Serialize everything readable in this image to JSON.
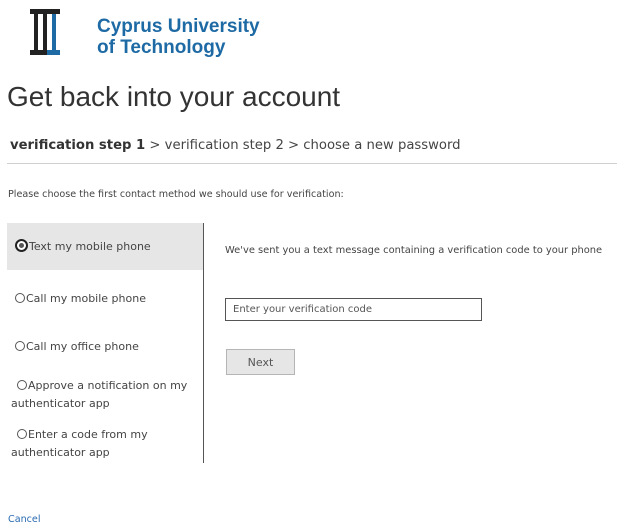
{
  "logo": {
    "line1": "Cyprus University",
    "line2": "of Technology",
    "brand_color": "#1e6aa5"
  },
  "page_title": "Get back into your account",
  "steps": {
    "current": "verification step 1",
    "rest": " > verification step 2 > choose a new password"
  },
  "instructions": "Please choose the first contact method we should use for verification:",
  "methods": [
    {
      "label": "Text my mobile phone",
      "selected": true
    },
    {
      "label": "Call my mobile phone",
      "selected": false
    },
    {
      "label": "Call my office phone",
      "selected": false
    },
    {
      "label": "Approve a notification on my authenticator app",
      "selected": false
    },
    {
      "label": "Enter a code from my authenticator app",
      "selected": false
    }
  ],
  "message": "We've sent you a text message containing a verification code to your phone",
  "code_input": {
    "value": "",
    "placeholder": "Enter your verification code"
  },
  "next_label": "Next",
  "cancel_label": "Cancel"
}
